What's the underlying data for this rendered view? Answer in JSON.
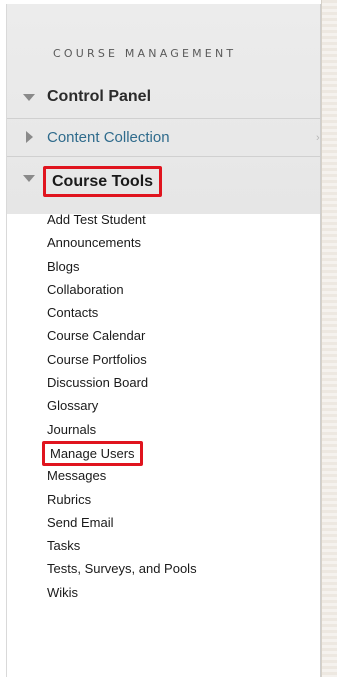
{
  "sidebar": {
    "section_title": "COURSE MANAGEMENT",
    "control_panel": {
      "label": "Control Panel",
      "icon": "triangle-down-icon"
    },
    "content_collection": {
      "label": "Content Collection",
      "icon": "triangle-right-icon",
      "chevron": "›"
    },
    "course_tools": {
      "label": "Course Tools",
      "icon": "triangle-down-icon",
      "highlight_color": "#e0141e",
      "items": [
        {
          "label": "Add Test Student"
        },
        {
          "label": "Announcements"
        },
        {
          "label": "Blogs"
        },
        {
          "label": "Collaboration"
        },
        {
          "label": "Contacts"
        },
        {
          "label": "Course Calendar"
        },
        {
          "label": "Course Portfolios"
        },
        {
          "label": "Discussion Board"
        },
        {
          "label": "Glossary"
        },
        {
          "label": "Journals"
        },
        {
          "label": "Manage Users",
          "highlighted": true
        },
        {
          "label": "Messages"
        },
        {
          "label": "Rubrics"
        },
        {
          "label": "Send Email"
        },
        {
          "label": "Tasks"
        },
        {
          "label": "Tests, Surveys, and Pools"
        },
        {
          "label": "Wikis"
        }
      ]
    }
  }
}
